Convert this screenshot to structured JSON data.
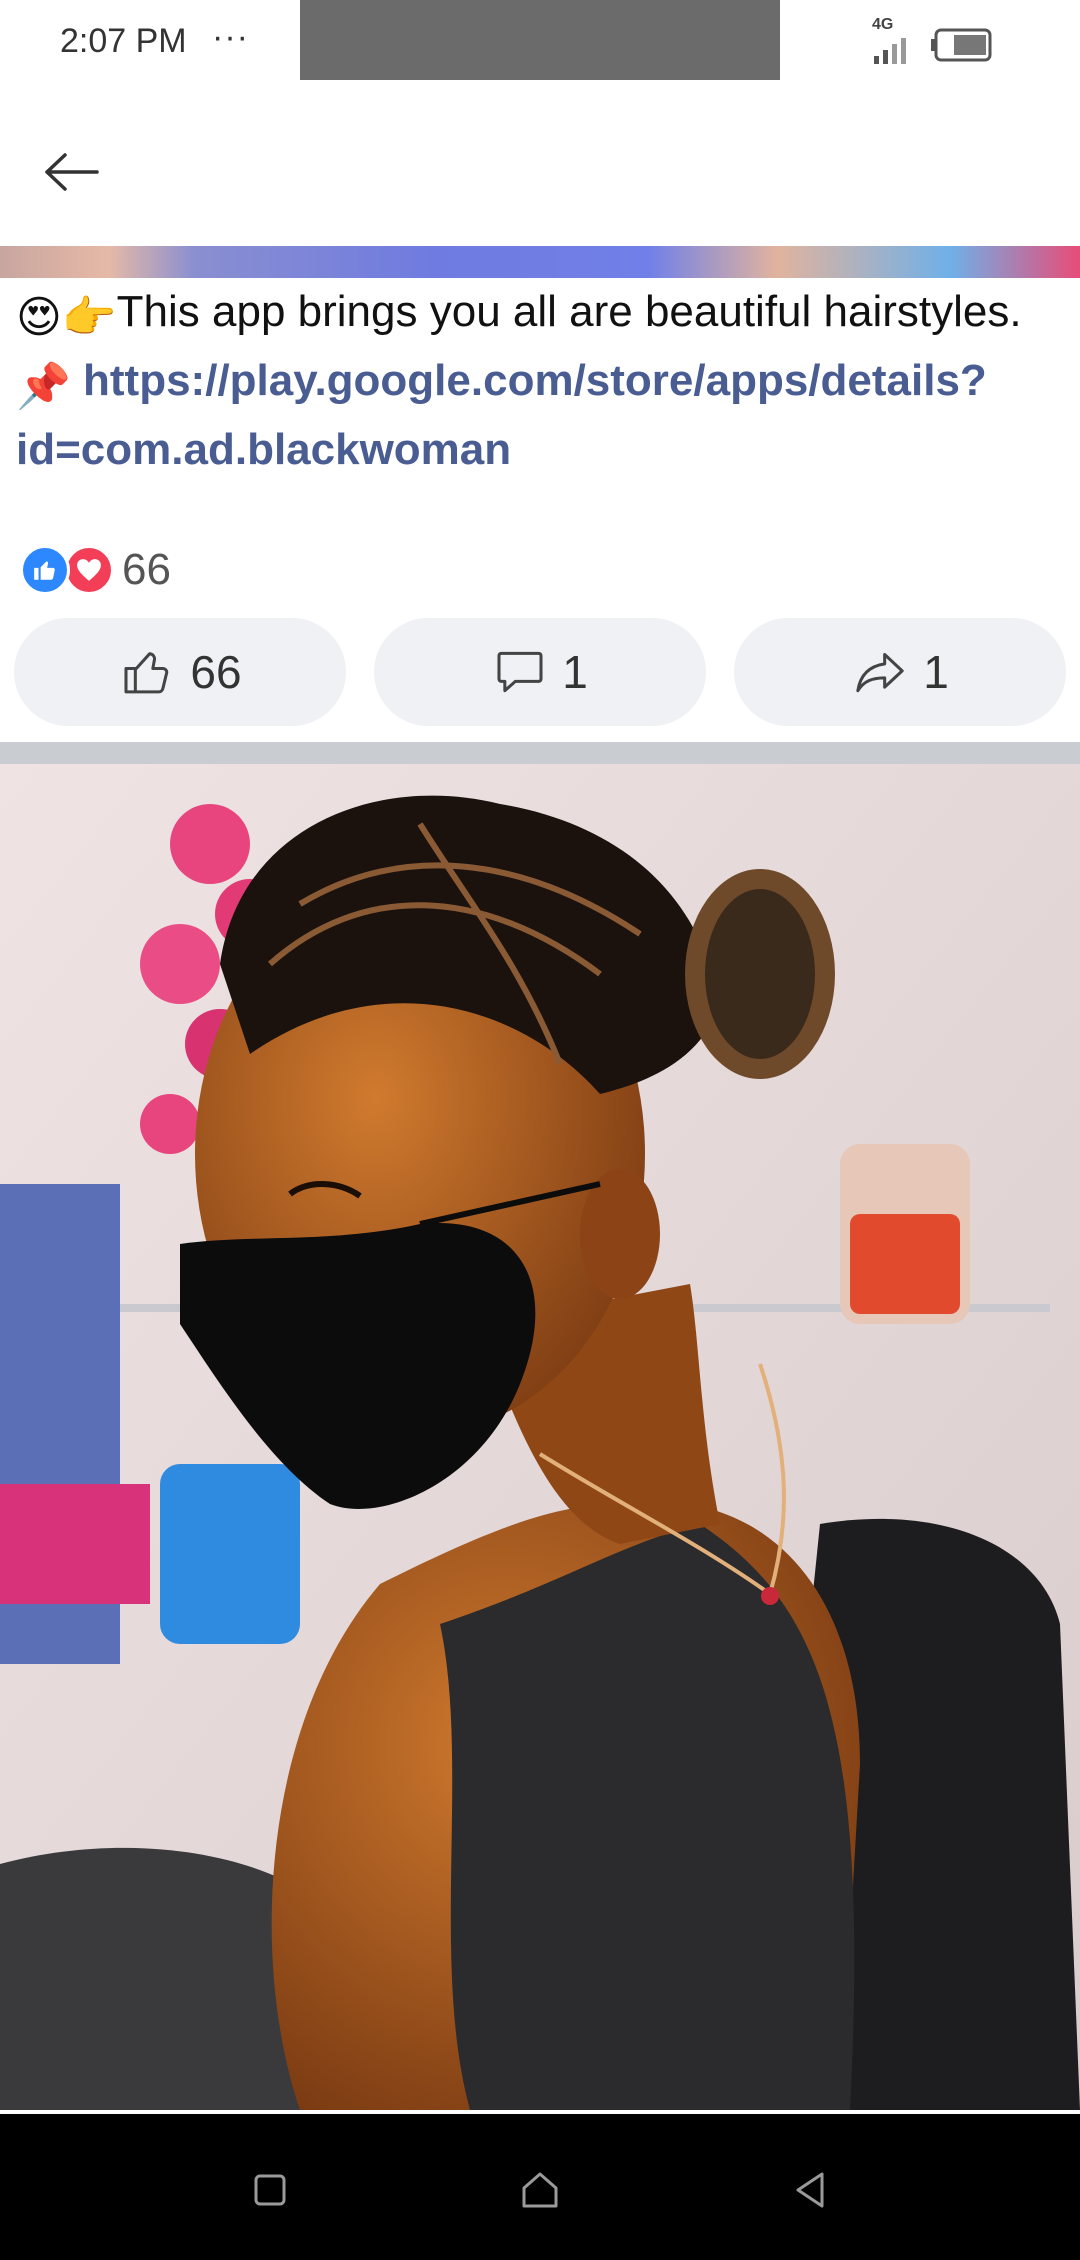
{
  "status_bar": {
    "time": "2:07 PM",
    "dots": "···",
    "network": "4G"
  },
  "top_bar": {
    "back_icon": "arrow-left-icon"
  },
  "post": {
    "emoji_1": "😍",
    "emoji_2": "👉",
    "text_1": "This app brings you all are beautiful hairstyles.",
    "emoji_3": "📌",
    "link": "https://play.google.com/store/apps/details?id=com.ad.blackwoman"
  },
  "reactions": {
    "icons": [
      "like-reaction-icon",
      "love-reaction-icon"
    ],
    "count": "66"
  },
  "actions": {
    "like_count": "66",
    "comment_count": "1",
    "share_count": "1"
  },
  "photo": {
    "subject": "woman with braided hairstyle wearing a black mask"
  },
  "colors": {
    "link": "#4a5d92",
    "like_blue": "#2d88ff",
    "love_red": "#f33e58",
    "button_bg": "#eff1f5"
  }
}
